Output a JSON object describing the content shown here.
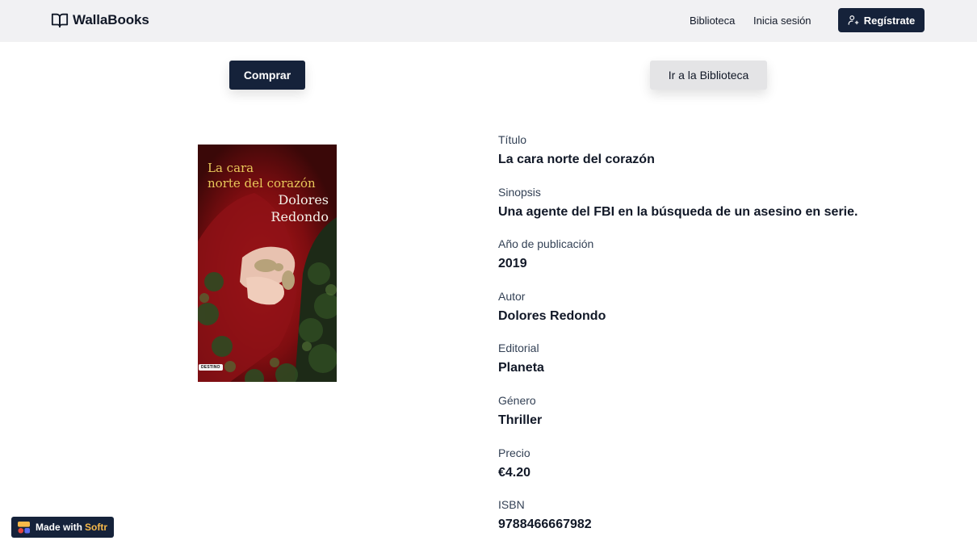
{
  "header": {
    "brand": "WallaBooks",
    "nav_biblioteca": "Biblioteca",
    "nav_login": "Inicia sesión",
    "register_label": "Regístrate"
  },
  "actions": {
    "buy_label": "Comprar",
    "library_label": "Ir a la Biblioteca"
  },
  "cover": {
    "title_line1": "La cara",
    "title_line2": "norte del corazón",
    "author_line1": "Dolores",
    "author_line2": "Redondo",
    "publisher": "DESTINO"
  },
  "book": {
    "fields": [
      {
        "label": "Título",
        "value": "La cara norte del corazón"
      },
      {
        "label": "Sinopsis",
        "value": "Una agente del FBI en la búsqueda de un asesino en serie."
      },
      {
        "label": "Año de publicación",
        "value": "2019"
      },
      {
        "label": "Autor",
        "value": "Dolores Redondo"
      },
      {
        "label": "Editorial",
        "value": "Planeta"
      },
      {
        "label": "Género",
        "value": "Thriller"
      },
      {
        "label": "Precio",
        "value": "€4.20"
      },
      {
        "label": "ISBN",
        "value": "9788466667982"
      }
    ]
  },
  "badge": {
    "made_with": "Made with",
    "brand": "Softr"
  },
  "colors": {
    "primary": "#15223a",
    "navbar_bg": "#f1f1f3",
    "secondary_button": "#e4e4e6",
    "badge_accent": "#f7b94a"
  }
}
